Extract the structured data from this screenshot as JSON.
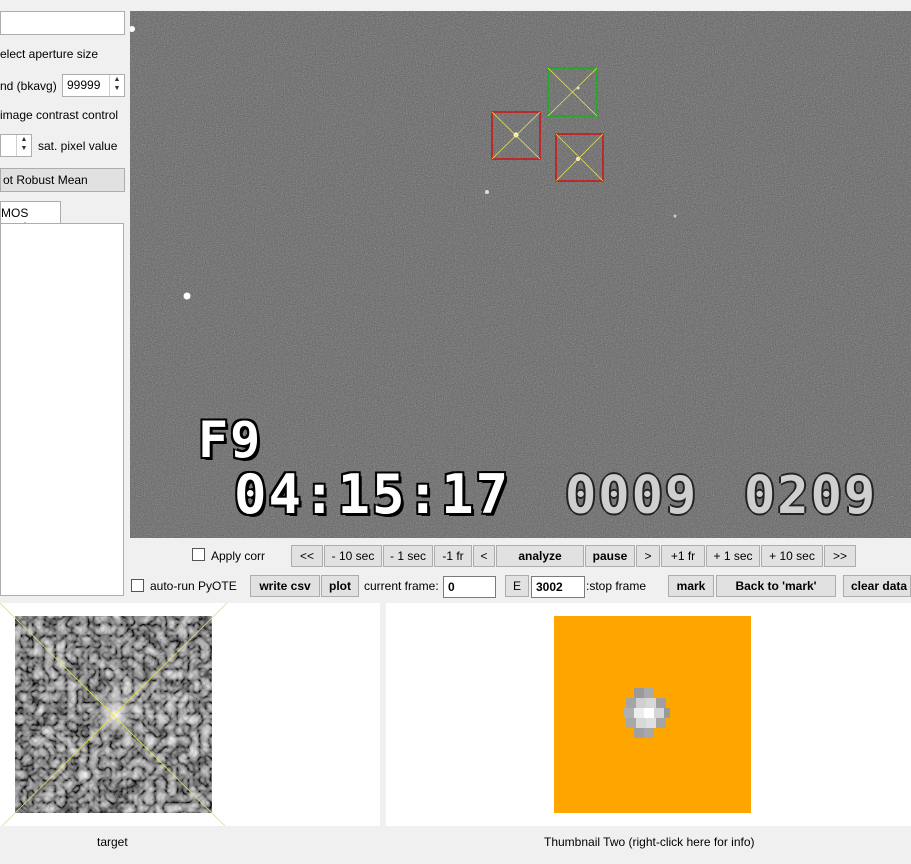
{
  "left_panel": {
    "top_input_value": "",
    "aperture_label": "elect aperture size",
    "bkavg_label": "nd (bkavg)",
    "bkavg_value": "99999",
    "contrast_label": "image contrast control",
    "sat_pixel_label": "sat. pixel value",
    "robust_mean_button": "ot Robust Mean",
    "tab_label": "MOS tools"
  },
  "video": {
    "osd_line1": "F9",
    "osd_time": "04:15:17",
    "osd_field1": "0009",
    "osd_field2": "0209",
    "aperture_colors": {
      "green": "#00c000",
      "red": "#e00000",
      "cross": "#e8e060"
    },
    "background_color": "#5e5e5e"
  },
  "controls_row1": {
    "apply_corr_label": "Apply corr",
    "back_back": "<<",
    "minus_10_sec": "- 10 sec",
    "minus_1_sec": "- 1 sec",
    "minus_1_fr": "-1 fr",
    "back": "<",
    "analyze": "analyze",
    "pause": "pause",
    "forward": ">",
    "plus_1_fr": "+1 fr",
    "plus_1_sec": "+ 1 sec",
    "plus_10_sec": "+ 10 sec",
    "forward_forward": ">>"
  },
  "controls_row2": {
    "auto_run_label": "auto-run PyOTE",
    "write_csv": "write csv",
    "plot": "plot",
    "current_frame_label": "current frame:",
    "current_frame_value": "0",
    "e_button": "E",
    "stop_frame_value": "3002",
    "stop_frame_label": ":stop frame",
    "mark": "mark",
    "back_to_mark": "Back to 'mark'",
    "clear_data": "clear data"
  },
  "thumbnails": {
    "target_caption": "target",
    "thumb_two_caption": "Thumbnail Two (right-click here for info)",
    "thumb_two_bg": "#ffa500"
  }
}
